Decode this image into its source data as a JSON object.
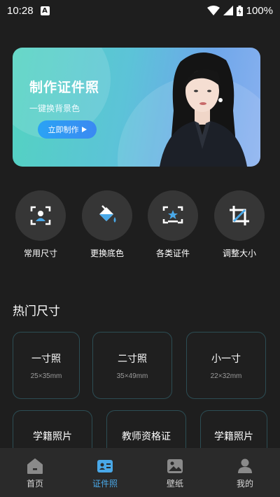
{
  "status_bar": {
    "time": "10:28",
    "battery": "100%"
  },
  "banner": {
    "title": "制作证件照",
    "subtitle": "一键换背景色",
    "button_label": "立即制作"
  },
  "features": [
    {
      "label": "常用尺寸",
      "icon": "face-scan-icon"
    },
    {
      "label": "更换底色",
      "icon": "paint-bucket-icon"
    },
    {
      "label": "各类证件",
      "icon": "id-card-star-icon"
    },
    {
      "label": "调整大小",
      "icon": "crop-icon"
    }
  ],
  "section_title": "热门尺寸",
  "sizes": [
    {
      "name": "一寸照",
      "dims": "25×35mm"
    },
    {
      "name": "二寸照",
      "dims": "35×49mm"
    },
    {
      "name": "小一寸",
      "dims": "22×32mm"
    },
    {
      "name": "学籍照片"
    },
    {
      "name": "教师资格证"
    },
    {
      "name": "学籍照片"
    }
  ],
  "nav": [
    {
      "label": "首页",
      "icon": "home-icon"
    },
    {
      "label": "证件照",
      "icon": "id-photo-icon",
      "active": true
    },
    {
      "label": "壁纸",
      "icon": "wallpaper-icon"
    },
    {
      "label": "我的",
      "icon": "profile-icon"
    }
  ],
  "colors": {
    "accent": "#49a8e8",
    "background": "#1e1e1e",
    "card_border": "#2c4d54"
  }
}
